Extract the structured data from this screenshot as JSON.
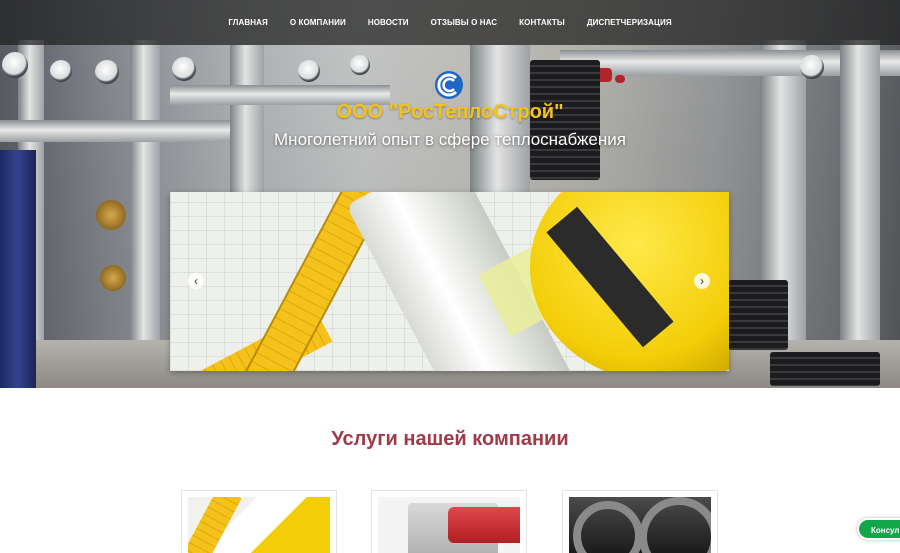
{
  "nav": {
    "items": [
      {
        "label": "ГЛАВНАЯ"
      },
      {
        "label": "О КОМПАНИИ"
      },
      {
        "label": "НОВОСТИ"
      },
      {
        "label": "ОТЗЫВЫ О НАС"
      },
      {
        "label": "КОНТАКТЫ"
      },
      {
        "label": "ДИСПЕТЧЕРИЗАЦИЯ"
      }
    ]
  },
  "brand": {
    "title": "ООО \"РосТеплоСтрой\"",
    "subtitle": "Многолетний опыт в сфере теплоснабжения",
    "logo_icon": "company-logo-icon",
    "title_color": "#f3c21b"
  },
  "slider": {
    "prev_glyph": "‹",
    "next_glyph": "›"
  },
  "services": {
    "title": "Услуги нашей компании",
    "title_color": "#a03a4a"
  },
  "consult_button": {
    "label": "Консул",
    "color": "#12a64a"
  }
}
